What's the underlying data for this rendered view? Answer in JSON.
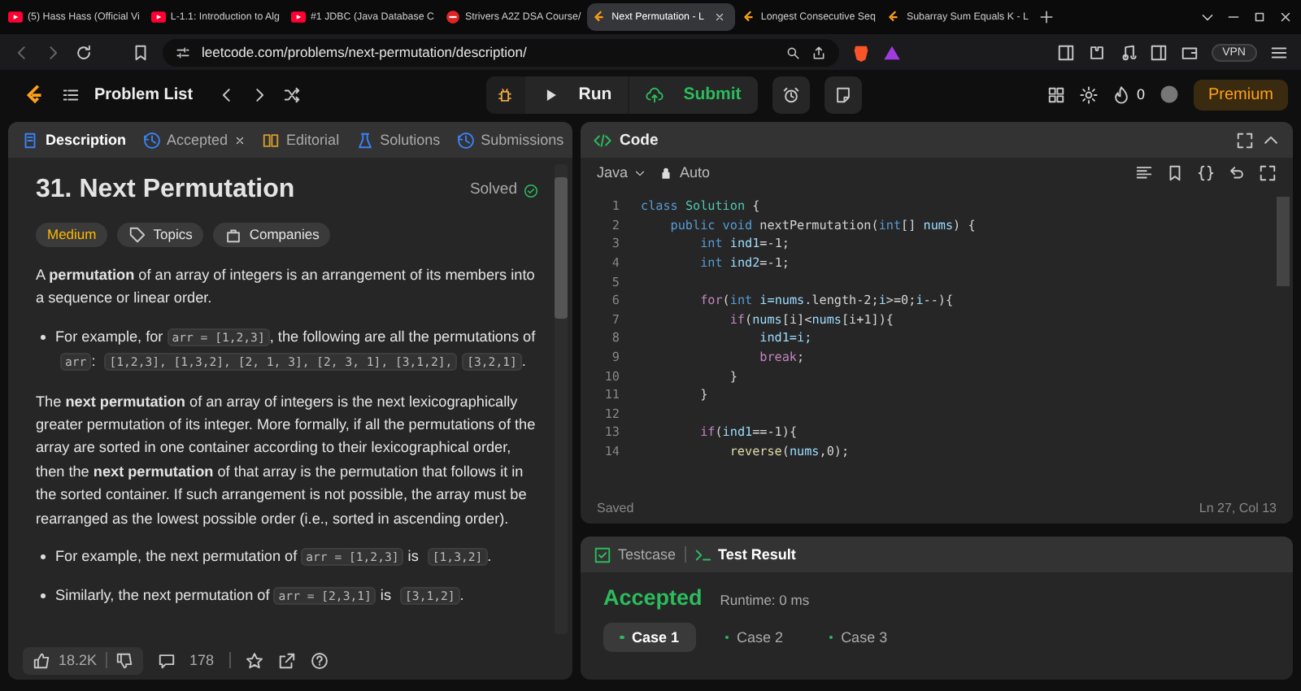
{
  "browser": {
    "tabs": [
      {
        "kind": "youtube",
        "title": "(5) Hass Hass (Official Vi",
        "selected": false
      },
      {
        "kind": "youtube",
        "title": "L-1.1: Introduction to Alg",
        "selected": false
      },
      {
        "kind": "youtube",
        "title": "#1 JDBC (Java Database C",
        "selected": false
      },
      {
        "kind": "course",
        "title": "Strivers A2Z DSA Course/",
        "selected": false
      },
      {
        "kind": "leetcode",
        "title": "Next Permutation - L",
        "selected": true
      },
      {
        "kind": "leetcode",
        "title": "Longest Consecutive Seq",
        "selected": false
      },
      {
        "kind": "leetcode",
        "title": "Subarray Sum Equals K - L",
        "selected": false
      }
    ],
    "url": "leetcode.com/problems/next-permutation/description/",
    "vpn": "VPN"
  },
  "header": {
    "problem_list": "Problem List",
    "run": "Run",
    "submit": "Submit",
    "streak": "0",
    "premium": "Premium"
  },
  "problem": {
    "tabs": [
      {
        "label": "Description",
        "selected": true,
        "closable": false
      },
      {
        "label": "Accepted",
        "selected": false,
        "closable": true
      },
      {
        "label": "Editorial",
        "selected": false,
        "closable": false
      },
      {
        "label": "Solutions",
        "selected": false,
        "closable": false
      },
      {
        "label": "Submissions",
        "selected": false,
        "closable": false
      }
    ],
    "title": "31. Next Permutation",
    "status": "Solved",
    "difficulty": "Medium",
    "tags": [
      "Topics",
      "Companies"
    ],
    "description": [
      {
        "kind": "paragraph",
        "parts": [
          {
            "kind": "text",
            "text": "A "
          },
          {
            "kind": "bold",
            "text": "permutation"
          },
          {
            "kind": "text",
            "text": " of an array of integers is an arrangement of its members into a sequence or linear order."
          }
        ]
      },
      {
        "kind": "bullet",
        "parts": [
          {
            "kind": "text",
            "text": "For example, for "
          },
          {
            "kind": "code",
            "text": "arr = [1,2,3]"
          },
          {
            "kind": "text",
            "text": ", the following are all the permutations of "
          },
          {
            "kind": "code",
            "text": "arr"
          },
          {
            "kind": "text",
            "text": ": "
          },
          {
            "kind": "code",
            "text": "[1,2,3], [1,3,2], [2, 1, 3], [2, 3, 1], [3,1,2],"
          },
          {
            "kind": "code",
            "text": "[3,2,1]"
          },
          {
            "kind": "text",
            "text": "."
          }
        ]
      },
      {
        "kind": "paragraph",
        "parts": [
          {
            "kind": "text",
            "text": "The "
          },
          {
            "kind": "bold",
            "text": "next permutation"
          },
          {
            "kind": "text",
            "text": " of an array of integers is the next lexicographically greater permutation of its integer. More formally, if all the permutations of the array are sorted in one container according to their lexicographical order, then the "
          },
          {
            "kind": "bold",
            "text": "next permutation"
          },
          {
            "kind": "text",
            "text": " of that array is the permutation that follows it in the sorted container. If such arrangement is not possible, the array must be rearranged as the lowest possible order (i.e., sorted in ascending order)."
          }
        ]
      },
      {
        "kind": "bullet",
        "parts": [
          {
            "kind": "text",
            "text": "For example, the next permutation of "
          },
          {
            "kind": "code",
            "text": "arr = [1,2,3]"
          },
          {
            "kind": "text",
            "text": " is "
          },
          {
            "kind": "code",
            "text": "[1,3,2]"
          },
          {
            "kind": "text",
            "text": "."
          }
        ]
      },
      {
        "kind": "bullet",
        "parts": [
          {
            "kind": "text",
            "text": "Similarly, the next permutation of "
          },
          {
            "kind": "code",
            "text": "arr = [2,3,1]"
          },
          {
            "kind": "text",
            "text": " is "
          },
          {
            "kind": "code",
            "text": "[3,1,2]"
          },
          {
            "kind": "text",
            "text": "."
          }
        ]
      }
    ],
    "likes": "18.2K",
    "comments": "178"
  },
  "code": {
    "title": "Code",
    "language": "Java",
    "mode": "Auto",
    "lines": [
      {
        "number": "1",
        "tokens": [
          {
            "text": "class ",
            "kind": "type"
          },
          {
            "text": "Solution",
            "kind": "class"
          },
          {
            "text": " {",
            "kind": "plain"
          }
        ]
      },
      {
        "number": "2",
        "tokens": [
          {
            "text": "    public void ",
            "kind": "type"
          },
          {
            "text": "nextPermutation(",
            "kind": "plain"
          },
          {
            "text": "int",
            "kind": "type"
          },
          {
            "text": "[] ",
            "kind": "plain"
          },
          {
            "text": "nums",
            "kind": "var"
          },
          {
            "text": ") {",
            "kind": "plain"
          }
        ]
      },
      {
        "number": "3",
        "tokens": [
          {
            "text": "        int ",
            "kind": "type"
          },
          {
            "text": "ind1",
            "kind": "var"
          },
          {
            "text": "=-1;",
            "kind": "plain"
          }
        ]
      },
      {
        "number": "4",
        "tokens": [
          {
            "text": "        int ",
            "kind": "type"
          },
          {
            "text": "ind2",
            "kind": "var"
          },
          {
            "text": "=-1;",
            "kind": "plain"
          }
        ]
      },
      {
        "number": "5"
      },
      {
        "number": "6",
        "tokens": [
          {
            "text": "        for",
            "kind": "keyword"
          },
          {
            "text": "(",
            "kind": "plain"
          },
          {
            "text": "int ",
            "kind": "type"
          },
          {
            "text": "i=nums",
            "kind": "var"
          },
          {
            "text": ".length-2;",
            "kind": "plain"
          },
          {
            "text": "i",
            "kind": "var"
          },
          {
            "text": ">=0;",
            "kind": "plain"
          },
          {
            "text": "i",
            "kind": "var"
          },
          {
            "text": "--){",
            "kind": "plain"
          }
        ]
      },
      {
        "number": "7",
        "tokens": [
          {
            "text": "            if",
            "kind": "keyword"
          },
          {
            "text": "(",
            "kind": "plain"
          },
          {
            "text": "nums",
            "kind": "var"
          },
          {
            "text": "[i]<",
            "kind": "plain"
          },
          {
            "text": "nums",
            "kind": "var"
          },
          {
            "text": "[i+1]){",
            "kind": "plain"
          }
        ]
      },
      {
        "number": "8",
        "tokens": [
          {
            "text": "                ind1=i;",
            "kind": "var"
          }
        ]
      },
      {
        "number": "9",
        "tokens": [
          {
            "text": "                break",
            "kind": "keyword"
          },
          {
            "text": ";",
            "kind": "plain"
          }
        ]
      },
      {
        "number": "10",
        "tokens": [
          {
            "text": "            }",
            "kind": "plain"
          }
        ]
      },
      {
        "number": "11",
        "tokens": [
          {
            "text": "        }",
            "kind": "plain"
          }
        ]
      },
      {
        "number": "12"
      },
      {
        "number": "13",
        "tokens": [
          {
            "text": "        if",
            "kind": "keyword"
          },
          {
            "text": "(",
            "kind": "plain"
          },
          {
            "text": "ind1",
            "kind": "var"
          },
          {
            "text": "==-1){",
            "kind": "plain"
          }
        ]
      },
      {
        "number": "14",
        "tokens": [
          {
            "text": "            reverse",
            "kind": "function"
          },
          {
            "text": "(",
            "kind": "plain"
          },
          {
            "text": "nums",
            "kind": "var"
          },
          {
            "text": ",0);",
            "kind": "plain"
          }
        ]
      }
    ],
    "status": "Saved",
    "cursor": "Ln 27, Col 13"
  },
  "result": {
    "tabs": [
      {
        "label": "Testcase",
        "selected": false
      },
      {
        "label": "Test Result",
        "selected": true
      }
    ],
    "verdict": "Accepted",
    "runtime": "Runtime: 0 ms",
    "cases": [
      {
        "label": "Case 1",
        "selected": true
      },
      {
        "label": "Case 2",
        "selected": false
      },
      {
        "label": "Case 3",
        "selected": false
      }
    ]
  }
}
